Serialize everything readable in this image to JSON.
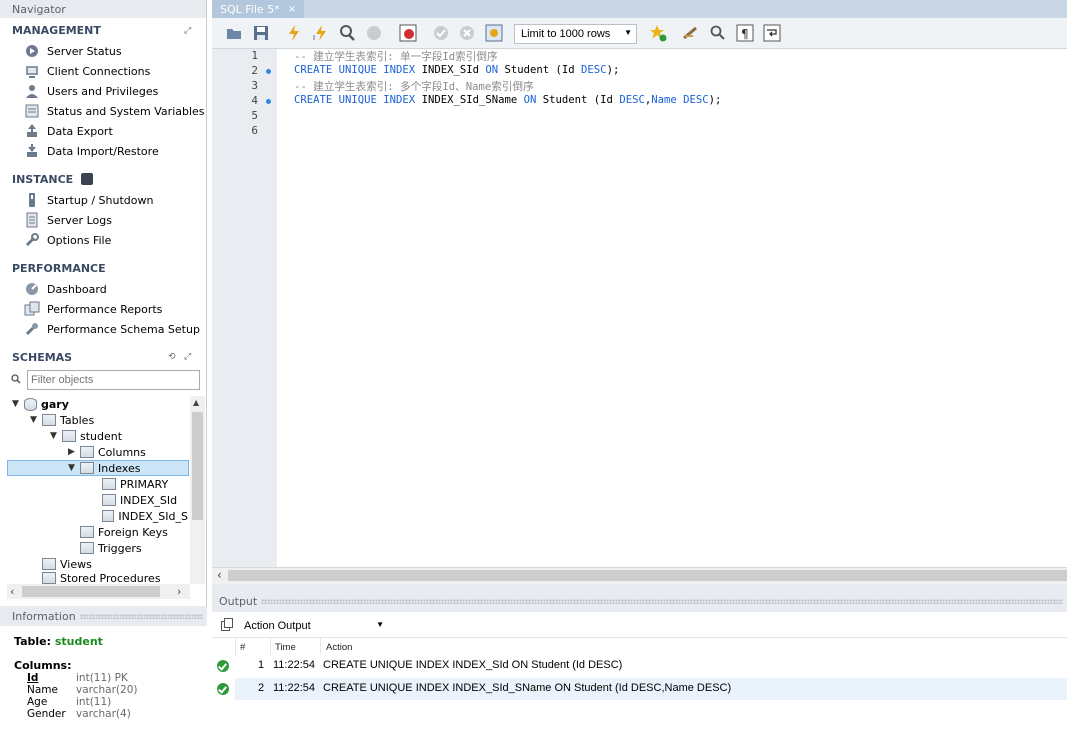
{
  "navigator": {
    "title": "Navigator",
    "management": {
      "title": "MANAGEMENT",
      "items": [
        {
          "label": "Server Status",
          "icon": "server-status-icon"
        },
        {
          "label": "Client Connections",
          "icon": "client-connections-icon"
        },
        {
          "label": "Users and Privileges",
          "icon": "users-icon"
        },
        {
          "label": "Status and System Variables",
          "icon": "variables-icon"
        },
        {
          "label": "Data Export",
          "icon": "data-export-icon"
        },
        {
          "label": "Data Import/Restore",
          "icon": "data-import-icon"
        }
      ]
    },
    "instance": {
      "title": "INSTANCE",
      "items": [
        {
          "label": "Startup / Shutdown",
          "icon": "startup-icon"
        },
        {
          "label": "Server Logs",
          "icon": "server-logs-icon"
        },
        {
          "label": "Options File",
          "icon": "wrench-icon"
        }
      ]
    },
    "performance": {
      "title": "PERFORMANCE",
      "items": [
        {
          "label": "Dashboard",
          "icon": "dashboard-icon"
        },
        {
          "label": "Performance Reports",
          "icon": "reports-icon"
        },
        {
          "label": "Performance Schema Setup",
          "icon": "schema-setup-icon"
        }
      ]
    },
    "schemas": {
      "title": "SCHEMAS",
      "filter_placeholder": "Filter objects",
      "tree": {
        "schema": "gary",
        "tables": "Tables",
        "table": "student",
        "columns": "Columns",
        "indexes": "Indexes",
        "index_items": [
          "PRIMARY",
          "INDEX_SId",
          "INDEX_SId_S"
        ],
        "foreign_keys": "Foreign Keys",
        "triggers": "Triggers",
        "views": "Views",
        "stored_procedures": "Stored Procedures"
      }
    }
  },
  "information": {
    "title": "Information",
    "table_label": "Table:",
    "table_name": "student",
    "columns_label": "Columns:",
    "columns": [
      {
        "name": "Id",
        "type": "int(11) PK"
      },
      {
        "name": "Name",
        "type": "varchar(20)"
      },
      {
        "name": "Age",
        "type": "int(11)"
      },
      {
        "name": "Gender",
        "type": "varchar(4)"
      }
    ]
  },
  "editor": {
    "tab_title": "SQL File 5*",
    "tab_close": "×",
    "limit": "Limit to 1000 rows",
    "line_numbers": [
      "1",
      "2",
      "3",
      "4",
      "5",
      "6"
    ],
    "lines": [
      [
        {
          "t": "-- 建立学生表索引: 单一字段Id索引倒序",
          "c": "cm"
        }
      ],
      [
        {
          "t": "CREATE UNIQUE INDEX",
          "c": "kw"
        },
        {
          "t": " INDEX_SId ",
          "c": ""
        },
        {
          "t": "ON",
          "c": "kw"
        },
        {
          "t": " Student (Id ",
          "c": ""
        },
        {
          "t": "DESC",
          "c": "kw"
        },
        {
          "t": ");",
          "c": ""
        }
      ],
      [
        {
          "t": "-- 建立学生表索引: 多个字段Id、Name索引倒序",
          "c": "cm"
        }
      ],
      [
        {
          "t": "CREATE UNIQUE INDEX",
          "c": "kw"
        },
        {
          "t": " INDEX_SId_SName ",
          "c": ""
        },
        {
          "t": "ON",
          "c": "kw"
        },
        {
          "t": " Student (Id ",
          "c": ""
        },
        {
          "t": "DESC",
          "c": "kw"
        },
        {
          "t": ",",
          "c": ""
        },
        {
          "t": "Name",
          "c": "kw"
        },
        {
          "t": " ",
          "c": ""
        },
        {
          "t": "DESC",
          "c": "kw"
        },
        {
          "t": ");",
          "c": ""
        }
      ],
      [],
      []
    ]
  },
  "output": {
    "title": "Output",
    "mode": "Action Output",
    "headers": [
      "#",
      "Time",
      "Action"
    ],
    "rows": [
      {
        "num": "1",
        "time": "11:22:54",
        "action": "CREATE UNIQUE INDEX INDEX_SId ON Student (Id DESC)",
        "status": "ok"
      },
      {
        "num": "2",
        "time": "11:22:54",
        "action": "CREATE UNIQUE INDEX INDEX_SId_SName ON Student (Id DESC,Name DESC)",
        "status": "ok"
      }
    ]
  },
  "colors": {
    "accent": "#2e86de",
    "keyword": "#1a62d6",
    "comment": "#8c8c8c",
    "ok": "#2f9a3a",
    "selection": "#cde6f7"
  }
}
